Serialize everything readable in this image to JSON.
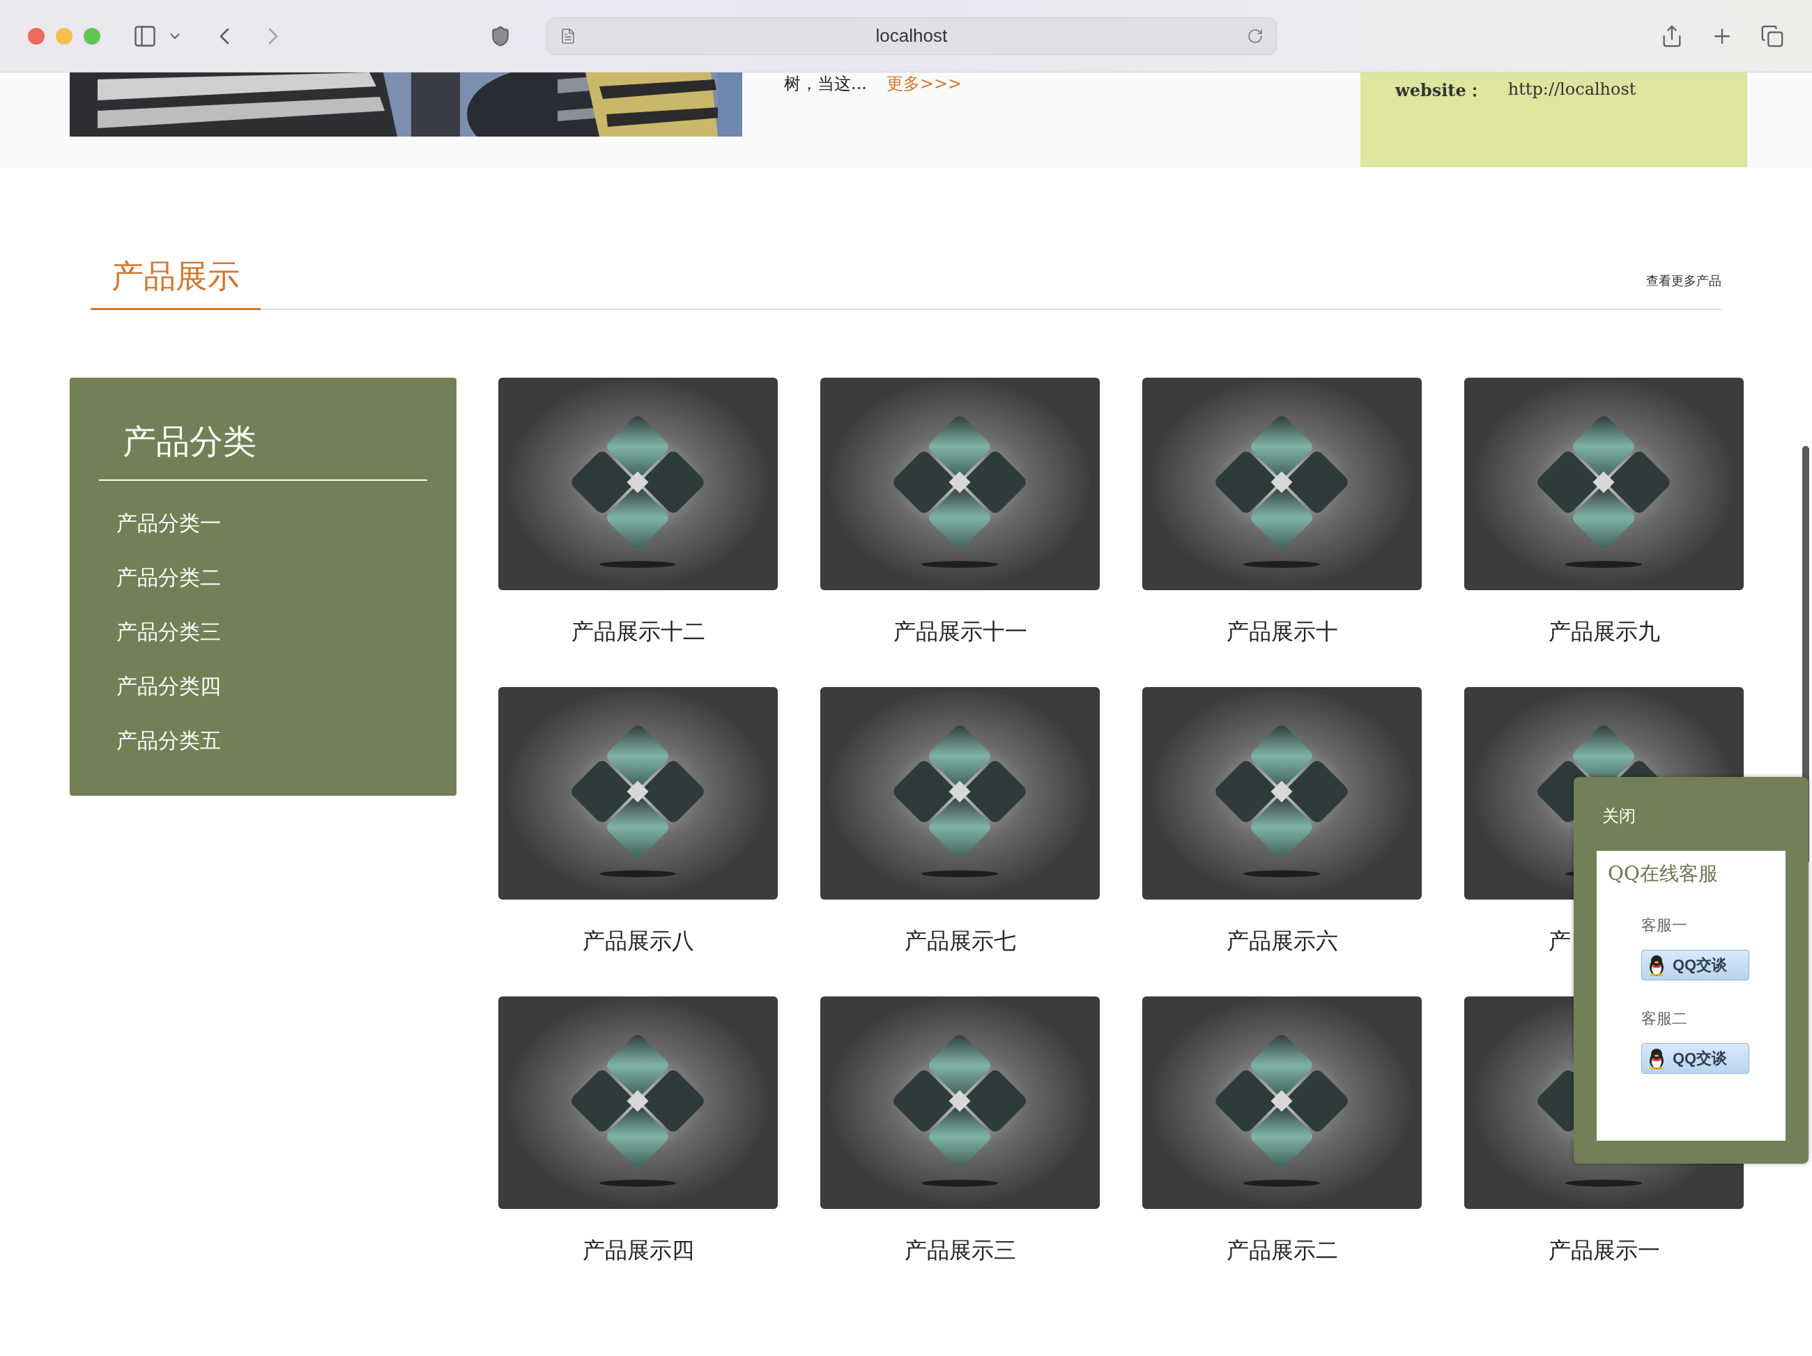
{
  "browser": {
    "address": "localhost"
  },
  "intro": {
    "text": "树，当这...",
    "more_link": "更多>>>"
  },
  "contact": {
    "label": "website：",
    "value": "http://localhost"
  },
  "section": {
    "title": "产品展示",
    "more_link": "查看更多产品"
  },
  "sidebar": {
    "title": "产品分类",
    "items": [
      "产品分类一",
      "产品分类二",
      "产品分类三",
      "产品分类四",
      "产品分类五"
    ]
  },
  "products": [
    {
      "caption": "产品展示十二"
    },
    {
      "caption": "产品展示十一"
    },
    {
      "caption": "产品展示十"
    },
    {
      "caption": "产品展示九"
    },
    {
      "caption": "产品展示八"
    },
    {
      "caption": "产品展示七"
    },
    {
      "caption": "产品展示六"
    },
    {
      "caption": "产"
    },
    {
      "caption": "产品展示四"
    },
    {
      "caption": "产品展示三"
    },
    {
      "caption": "产品展示二"
    },
    {
      "caption": "产品展示一"
    }
  ],
  "qq_panel": {
    "close": "关闭",
    "title": "QQ在线客服",
    "agents": [
      {
        "name": "客服一",
        "button": "QQ交谈"
      },
      {
        "name": "客服二",
        "button": "QQ交谈"
      }
    ]
  }
}
